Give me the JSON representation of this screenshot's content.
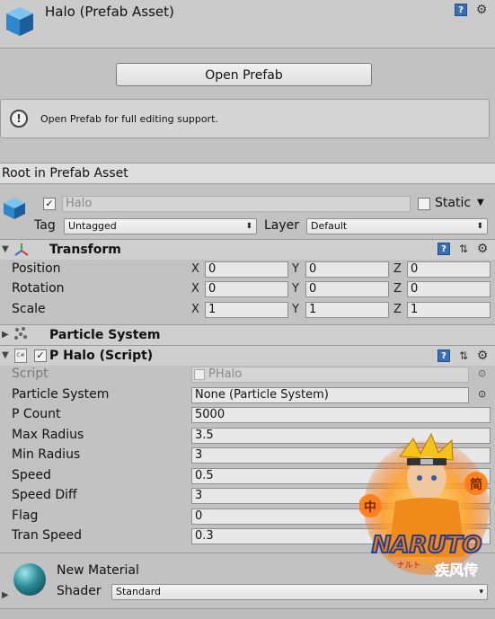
{
  "header": {
    "title": "Halo (Prefab Asset)"
  },
  "open_prefab": {
    "label": "Open Prefab"
  },
  "info": {
    "text": "Open Prefab for full editing support."
  },
  "root_bar": {
    "text": "Root in Prefab Asset"
  },
  "object": {
    "name": "Halo",
    "static_label": "Static",
    "tag_label": "Tag",
    "tag_value": "Untagged",
    "layer_label": "Layer",
    "layer_value": "Default"
  },
  "transform": {
    "title": "Transform",
    "rows": [
      {
        "label": "Position",
        "x": "0",
        "y": "0",
        "z": "0"
      },
      {
        "label": "Rotation",
        "x": "0",
        "y": "0",
        "z": "0"
      },
      {
        "label": "Scale",
        "x": "1",
        "y": "1",
        "z": "1"
      }
    ],
    "axes": [
      "X",
      "Y",
      "Z"
    ]
  },
  "particle_system": {
    "title": "Particle System"
  },
  "script_component": {
    "title": "P Halo (Script)",
    "rows": [
      {
        "label": "Script",
        "value": "PHalo"
      },
      {
        "label": "Particle System",
        "value": "None (Particle System)"
      },
      {
        "label": "P Count",
        "value": "5000"
      },
      {
        "label": "Max Radius",
        "value": "3.5"
      },
      {
        "label": "Min Radius",
        "value": "3"
      },
      {
        "label": "Speed",
        "value": "0.5"
      },
      {
        "label": "Speed Diff",
        "value": "3"
      },
      {
        "label": "Flag",
        "value": "0"
      },
      {
        "label": "Tran Speed",
        "value": "0.3"
      }
    ]
  },
  "material": {
    "name": "New Material",
    "shader_label": "Shader",
    "shader_value": "Standard"
  },
  "watermark": {
    "brand": "NARUTO",
    "subtitle": "ナルト",
    "left_char": "中",
    "right_char": "简",
    "cn_title": "疾风传"
  },
  "colors": {
    "help_icon": "#3a6fb2",
    "header_bg": "#cbcbcb",
    "panel_bg": "#c2c2c2"
  }
}
